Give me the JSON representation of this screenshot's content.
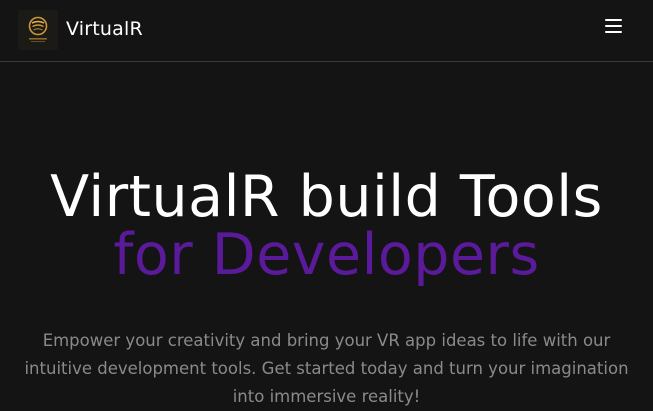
{
  "navbar": {
    "logo_icon": "virtualr-gold-emblem",
    "brand_name": "VirtualR",
    "menu_icon": "hamburger-menu-icon"
  },
  "hero": {
    "title_line1": "VirtualR build Tools",
    "title_line2": "for Developers",
    "title_line2_color": "#5a1a9a",
    "description": "Empower your creativity and bring your VR app ideas to life with our intuitive development tools. Get started today and turn your imagination into immersive reality!"
  },
  "colors": {
    "background": "#141414",
    "text_primary": "#ffffff",
    "text_muted": "#8a8a8a",
    "accent": "#5a1a9a"
  }
}
